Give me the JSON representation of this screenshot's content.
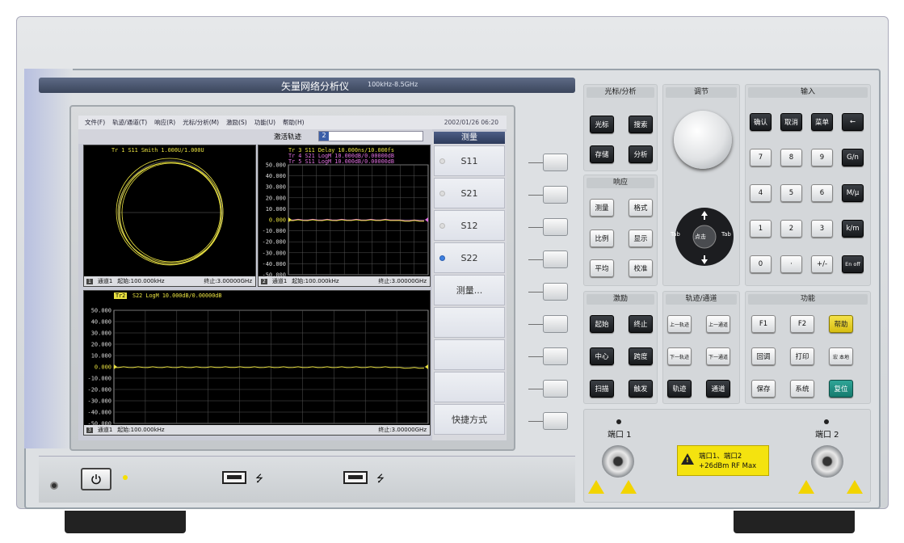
{
  "instrument": {
    "title": "矢量网络分析仪",
    "subtitle": "100kHz-8.5GHz"
  },
  "menu": {
    "items": [
      "文件(F)",
      "轨迹/通道(T)",
      "响应(R)",
      "光标/分析(M)",
      "激励(S)",
      "功能(U)",
      "帮助(H)"
    ],
    "datetime": "2002/01/26  06:20"
  },
  "active_trace": {
    "label": "激活轨迹",
    "value": "2"
  },
  "plot_smith": {
    "header": "Tr 1  S11 Smith 1.000U/1.000U",
    "footer_num": "1",
    "footer_channel": "通道1",
    "footer_start": "起始:100.000kHz",
    "footer_stop": "终止:3.00000GHz"
  },
  "plot_top_right": {
    "headers": [
      "Tr 3  S11 Delay 10.000ns/10.000fs",
      "Tr 4  S21 LogM 10.000dB/0.00000dB",
      "Tr 5  S11 LogM 10.000dB/0.00000dB"
    ],
    "yticks": [
      "50.000",
      "40.000",
      "30.000",
      "20.000",
      "10.000",
      "0.000",
      "-10.000",
      "-20.000",
      "-30.000",
      "-40.000",
      "-50.000"
    ],
    "footer_num": "2",
    "footer_channel": "通道1",
    "footer_start": "起始:100.000kHz",
    "footer_stop": "终止:3.00000GHz"
  },
  "plot_bottom": {
    "trace_tag": "Tr2",
    "header": "S22 LogM 10.000dB/0.00000dB",
    "yticks": [
      "50.000",
      "40.000",
      "30.000",
      "20.000",
      "10.000",
      "0.000",
      "-10.000",
      "-20.000",
      "-30.000",
      "-40.000",
      "-50.000"
    ],
    "footer_num": "3",
    "footer_channel": "通道1",
    "footer_start": "起始:100.000kHz",
    "footer_stop": "终止:3.00000GHz"
  },
  "softkeys": {
    "title": "测量",
    "items": [
      {
        "label": "S11",
        "radio": true,
        "selected": false
      },
      {
        "label": "S21",
        "radio": true,
        "selected": false
      },
      {
        "label": "S12",
        "radio": true,
        "selected": false
      },
      {
        "label": "S22",
        "radio": true,
        "selected": true
      },
      {
        "label": "测量...",
        "radio": false,
        "selected": false
      },
      {
        "label": "",
        "radio": false,
        "selected": false
      },
      {
        "label": "",
        "radio": false,
        "selected": false
      },
      {
        "label": "",
        "radio": false,
        "selected": false
      },
      {
        "label": "快捷方式",
        "radio": false,
        "selected": false
      }
    ]
  },
  "groups": {
    "marker": {
      "title": "光标/分析",
      "keys": [
        "光标",
        "搜索",
        "存储",
        "分析"
      ]
    },
    "adjust": {
      "title": "调节"
    },
    "input": {
      "title": "输入",
      "keys": [
        "确认",
        "取消",
        "菜单",
        "←",
        "7",
        "8",
        "9",
        "G/n",
        "4",
        "5",
        "6",
        "M/μ",
        "1",
        "2",
        "3",
        "k/m",
        "0",
        "·",
        "+/-",
        "En off"
      ]
    },
    "response": {
      "title": "响应",
      "keys": [
        "测量",
        "格式",
        "比例",
        "显示",
        "平均",
        "校准"
      ]
    },
    "stimulus": {
      "title": "激励",
      "keys": [
        "起始",
        "终止",
        "中心",
        "跨度",
        "扫描",
        "触发"
      ]
    },
    "trace": {
      "title": "轨迹/通道",
      "keys": [
        "上一轨迹",
        "上一通道",
        "下一轨迹",
        "下一通道",
        "轨迹",
        "通道"
      ]
    },
    "function": {
      "title": "功能",
      "keys": [
        "F1",
        "F2",
        "帮助",
        "回调",
        "打印",
        "宏 本地",
        "保存",
        "系统",
        "复位"
      ]
    }
  },
  "dpad": {
    "center": "点击",
    "left": "Tab",
    "right": "Tab"
  },
  "ports": {
    "port1": "端口 1",
    "port2": "端口 2"
  },
  "warning": {
    "line1": "端口1、端口2",
    "line2": "+26dBm RF  Max"
  },
  "colors": {
    "trace_yellow": "#e8e040",
    "trace_pink": "#e070e0",
    "accent_blue": "#3b5fa8"
  }
}
